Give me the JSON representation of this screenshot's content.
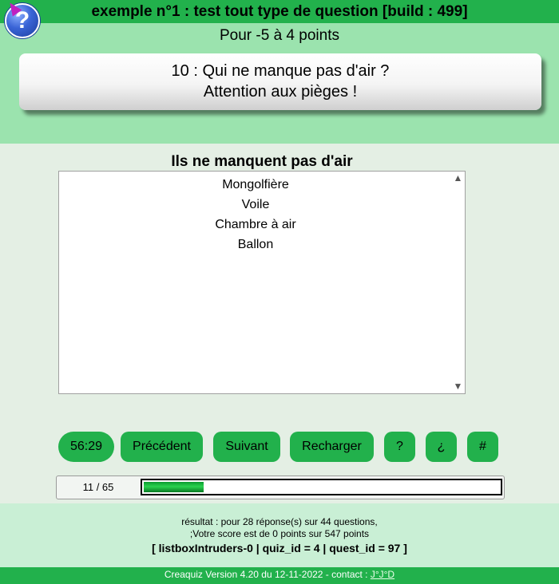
{
  "header": {
    "title": "exemple n°1 : test tout type de question [build : 499]",
    "help_icon": "question-mark-icon",
    "points": "Pour -5 à 4 points"
  },
  "question": {
    "line1": "10 : Qui ne manque pas d'air ?",
    "line2": "Attention aux pièges !"
  },
  "listbox": {
    "title": "Ils ne manquent pas d'air",
    "items": [
      "Mongolfière",
      "Voile",
      "Chambre à air",
      "Ballon"
    ]
  },
  "buttons": {
    "timer": "56:29",
    "previous": "Précédent",
    "next": "Suivant",
    "reload": "Recharger",
    "question_mark": "?",
    "inverted_question": "¿",
    "hash": "#"
  },
  "progress": {
    "label": "11 / 65",
    "current": 11,
    "total": 65
  },
  "footer": {
    "result_line1": "résultat : pour 28 réponse(s) sur 44 questions,",
    "result_line2": ";Votre score est de 0 points sur 547 points",
    "debug": "[ listboxIntruders-0 | quiz_id = 4 | quest_id = 97 ]",
    "version_text": "Creaquiz Version 4.20 du 12-11-2022 - contact : ",
    "contact_link": "J°J°D"
  },
  "colors": {
    "primary_green": "#22b14c",
    "header_zone": "#9be3ae",
    "footer_zone": "#c9efd5",
    "background": "#e4efe4"
  }
}
